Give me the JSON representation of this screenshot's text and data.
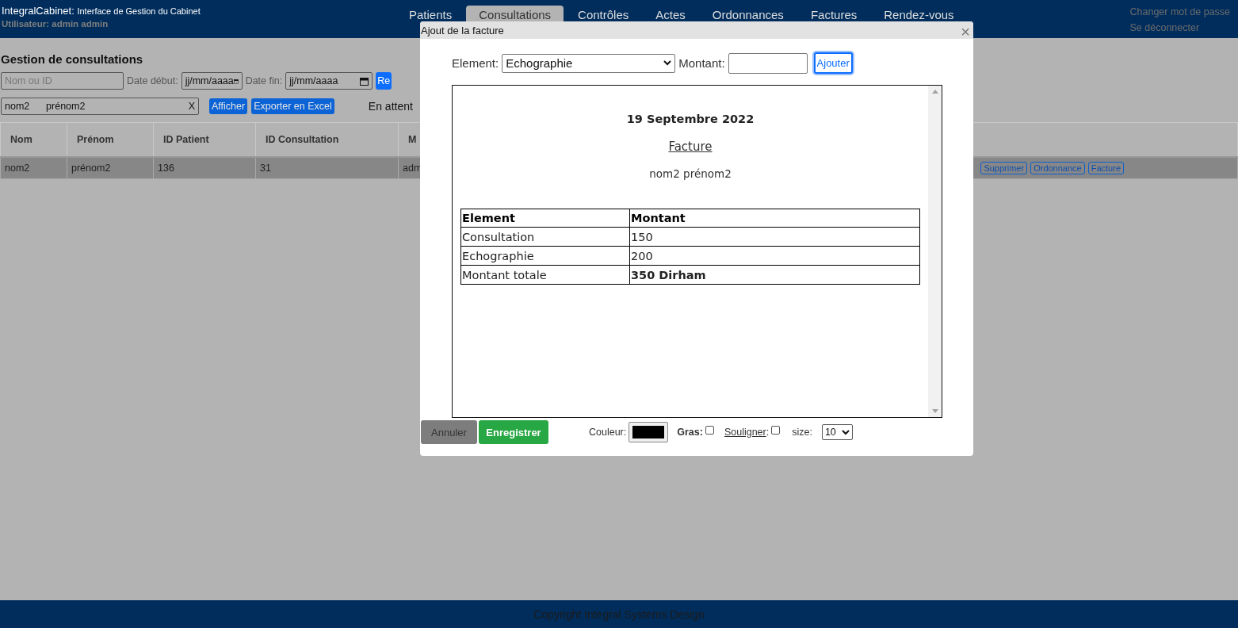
{
  "header": {
    "brand": "IntegralCabinet:",
    "subtitle": "Interface de Gestion du Cabinet",
    "user": "Utilisateur: admin admin",
    "tabs": [
      {
        "label": "Patients",
        "selected": false
      },
      {
        "label": "Consultations",
        "selected": true
      },
      {
        "label": "Contrôles",
        "selected": false
      },
      {
        "label": "Actes",
        "selected": false
      },
      {
        "label": "Ordonnances",
        "selected": false
      },
      {
        "label": "Factures",
        "selected": false
      },
      {
        "label": "Rendez-vous",
        "selected": false
      }
    ],
    "links": [
      "Changer mot de passe",
      "Se déconnecter"
    ]
  },
  "page": {
    "title": "Gestion de consultations",
    "filters": {
      "search_placeholder": "Nom ou ID",
      "start_label": "Date début:",
      "start_placeholder": "jj/mm/aaaa",
      "end_label": "Date fin:",
      "end_placeholder": "jj/mm/aaaa",
      "button": "Re"
    },
    "selection": {
      "value": "nom2      prénom2",
      "clear": "X",
      "buttons": [
        "Afficher",
        "Exporter en Excel"
      ],
      "status": "En attent"
    },
    "table": {
      "columns": [
        "Nom",
        "Prénom",
        "ID Patient",
        "ID Consultation",
        "M"
      ],
      "rows": [
        {
          "cells": [
            "nom2",
            "prénom2",
            "136",
            "31",
            "adm"
          ],
          "actions": [
            "Supprimer",
            "Ordonnance",
            "Facture"
          ]
        }
      ]
    }
  },
  "modal": {
    "title": "Ajout de la facture",
    "close": "×",
    "element_label": "Element:",
    "element_value": "Echographie",
    "amount_label": "Montant:",
    "add_button": "Ajouter",
    "invoice": {
      "date": "19 Septembre 2022",
      "heading": "Facture",
      "patient": "nom2 prénom2",
      "columns": [
        "Element",
        "Montant"
      ],
      "rows": [
        {
          "kind": "item",
          "cells": [
            "Consultation",
            "150"
          ]
        },
        {
          "kind": "item",
          "cells": [
            "Echographie",
            "200"
          ]
        },
        {
          "kind": "total",
          "cells": [
            "Montant totale",
            "350 Dirham"
          ]
        }
      ]
    },
    "cancel": "Annuler",
    "save": "Enregistrer",
    "color_label": "Couleur:",
    "color": "#000000",
    "bold_label": "Gras:",
    "bold": false,
    "underline_label": "Souligner",
    "underline_colon": ":",
    "underline": false,
    "size_label": "size:",
    "size": "10"
  },
  "footer": {
    "copyright": "Copyright Integral Systems Design"
  }
}
